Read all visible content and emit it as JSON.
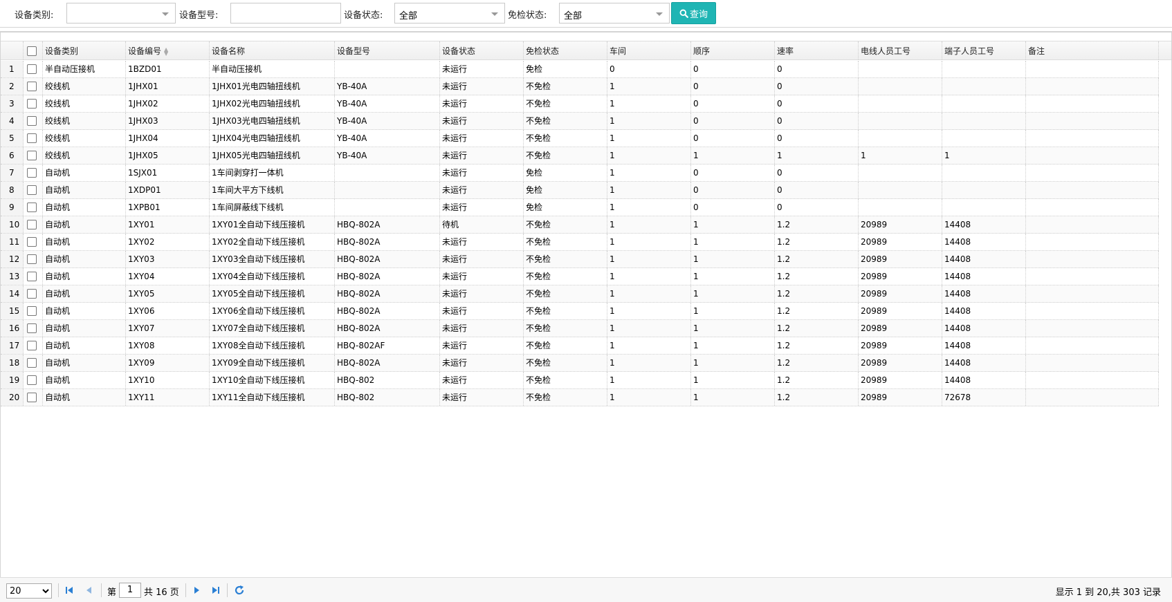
{
  "filters": {
    "category_label": "设备类别:",
    "category_value": "",
    "model_label": "设备型号:",
    "model_value": "",
    "status_label": "设备状态:",
    "status_value": "全部",
    "exempt_label": "免检状态:",
    "exempt_value": "全部",
    "query_label": "查询"
  },
  "columns": [
    "设备类别",
    "设备编号",
    "设备名称",
    "设备型号",
    "设备状态",
    "免检状态",
    "车间",
    "顺序",
    "速率",
    "电线人员工号",
    "端子人员工号",
    "备注"
  ],
  "rows": [
    {
      "n": "1",
      "c": [
        "半自动压接机",
        "1BZD01",
        "半自动压接机",
        "",
        "未运行",
        "免检",
        "0",
        "0",
        "0",
        "",
        "",
        ""
      ]
    },
    {
      "n": "2",
      "c": [
        "绞线机",
        "1JHX01",
        "1JHX01光电四轴扭线机",
        "YB-40A",
        "未运行",
        "不免检",
        "1",
        "0",
        "0",
        "",
        "",
        ""
      ]
    },
    {
      "n": "3",
      "c": [
        "绞线机",
        "1JHX02",
        "1JHX02光电四轴扭线机",
        "YB-40A",
        "未运行",
        "不免检",
        "1",
        "0",
        "0",
        "",
        "",
        ""
      ]
    },
    {
      "n": "4",
      "c": [
        "绞线机",
        "1JHX03",
        "1JHX03光电四轴扭线机",
        "YB-40A",
        "未运行",
        "不免检",
        "1",
        "0",
        "0",
        "",
        "",
        ""
      ]
    },
    {
      "n": "5",
      "c": [
        "绞线机",
        "1JHX04",
        "1JHX04光电四轴扭线机",
        "YB-40A",
        "未运行",
        "不免检",
        "1",
        "0",
        "0",
        "",
        "",
        ""
      ]
    },
    {
      "n": "6",
      "c": [
        "绞线机",
        "1JHX05",
        "1JHX05光电四轴扭线机",
        "YB-40A",
        "未运行",
        "不免检",
        "1",
        "1",
        "1",
        "1",
        "1",
        ""
      ]
    },
    {
      "n": "7",
      "c": [
        "自动机",
        "1SJX01",
        "1车间剥穿打一体机",
        "",
        "未运行",
        "免检",
        "1",
        "0",
        "0",
        "",
        "",
        ""
      ]
    },
    {
      "n": "8",
      "c": [
        "自动机",
        "1XDP01",
        "1车间大平方下线机",
        "",
        "未运行",
        "免检",
        "1",
        "0",
        "0",
        "",
        "",
        ""
      ]
    },
    {
      "n": "9",
      "c": [
        "自动机",
        "1XPB01",
        "1车间屏蔽线下线机",
        "",
        "未运行",
        "免检",
        "1",
        "0",
        "0",
        "",
        "",
        ""
      ]
    },
    {
      "n": "10",
      "c": [
        "自动机",
        "1XY01",
        "1XY01全自动下线压接机",
        "HBQ-802A",
        "待机",
        "不免检",
        "1",
        "1",
        "1.2",
        "20989",
        "14408",
        ""
      ]
    },
    {
      "n": "11",
      "c": [
        "自动机",
        "1XY02",
        "1XY02全自动下线压接机",
        "HBQ-802A",
        "未运行",
        "不免检",
        "1",
        "1",
        "1.2",
        "20989",
        "14408",
        ""
      ]
    },
    {
      "n": "12",
      "c": [
        "自动机",
        "1XY03",
        "1XY03全自动下线压接机",
        "HBQ-802A",
        "未运行",
        "不免检",
        "1",
        "1",
        "1.2",
        "20989",
        "14408",
        ""
      ]
    },
    {
      "n": "13",
      "c": [
        "自动机",
        "1XY04",
        "1XY04全自动下线压接机",
        "HBQ-802A",
        "未运行",
        "不免检",
        "1",
        "1",
        "1.2",
        "20989",
        "14408",
        ""
      ]
    },
    {
      "n": "14",
      "c": [
        "自动机",
        "1XY05",
        "1XY05全自动下线压接机",
        "HBQ-802A",
        "未运行",
        "不免检",
        "1",
        "1",
        "1.2",
        "20989",
        "14408",
        ""
      ]
    },
    {
      "n": "15",
      "c": [
        "自动机",
        "1XY06",
        "1XY06全自动下线压接机",
        "HBQ-802A",
        "未运行",
        "不免检",
        "1",
        "1",
        "1.2",
        "20989",
        "14408",
        ""
      ]
    },
    {
      "n": "16",
      "c": [
        "自动机",
        "1XY07",
        "1XY07全自动下线压接机",
        "HBQ-802A",
        "未运行",
        "不免检",
        "1",
        "1",
        "1.2",
        "20989",
        "14408",
        ""
      ]
    },
    {
      "n": "17",
      "c": [
        "自动机",
        "1XY08",
        "1XY08全自动下线压接机",
        "HBQ-802AF",
        "未运行",
        "不免检",
        "1",
        "1",
        "1.2",
        "20989",
        "14408",
        ""
      ]
    },
    {
      "n": "18",
      "c": [
        "自动机",
        "1XY09",
        "1XY09全自动下线压接机",
        "HBQ-802A",
        "未运行",
        "不免检",
        "1",
        "1",
        "1.2",
        "20989",
        "14408",
        ""
      ]
    },
    {
      "n": "19",
      "c": [
        "自动机",
        "1XY10",
        "1XY10全自动下线压接机",
        "HBQ-802",
        "未运行",
        "不免检",
        "1",
        "1",
        "1.2",
        "20989",
        "14408",
        ""
      ]
    },
    {
      "n": "20",
      "c": [
        "自动机",
        "1XY11",
        "1XY11全自动下线压接机",
        "HBQ-802",
        "未运行",
        "不免检",
        "1",
        "1",
        "1.2",
        "20989",
        "72678",
        ""
      ]
    }
  ],
  "pager": {
    "page_size": "20",
    "page_prefix": "第",
    "current_page": "1",
    "page_suffix": "共 16 页",
    "info": "显示 1 到 20,共 303 记录"
  },
  "colors": {
    "accent": "#1fb5b4",
    "icon_blue": "#2a7fd4"
  },
  "icons": [
    "search-icon",
    "first-page-icon",
    "prev-page-icon",
    "next-page-icon",
    "last-page-icon",
    "refresh-icon",
    "sort-icon",
    "chevron-down-icon"
  ]
}
